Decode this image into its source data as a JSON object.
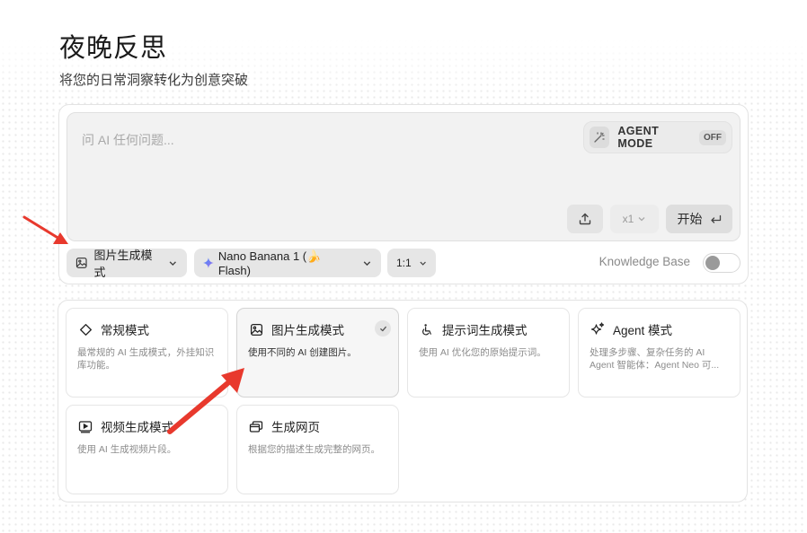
{
  "header": {
    "title": "夜晚反思",
    "subtitle": "将您的日常洞察转化为创意突破"
  },
  "composer": {
    "placeholder": "问 AI 任何问题...",
    "agent_mode_label": "AGENT MODE",
    "agent_mode_state": "OFF",
    "count_label": "x1",
    "start_label": "开始"
  },
  "options": {
    "mode_label": "图片生成模式",
    "model_label": "Nano Banana 1 (🍌 Flash)",
    "ratio_label": "1:1",
    "knowledge_base_label": "Knowledge Base",
    "knowledge_base_on": false
  },
  "modes": [
    {
      "title": "常规模式",
      "desc": "最常规的 AI 生成模式，外挂知识库功能。",
      "icon": "diamond-icon",
      "selected": false
    },
    {
      "title": "图片生成模式",
      "desc": "使用不同的 AI 创建图片。",
      "icon": "image-icon",
      "selected": true
    },
    {
      "title": "提示词生成模式",
      "desc": "使用 AI 优化您的原始提示词。",
      "icon": "wheelchair-icon",
      "selected": false
    },
    {
      "title": "Agent 模式",
      "desc": "处理多步骤、复杂任务的 AI Agent 智能体：Agent Neo 可...",
      "icon": "sparkles-icon",
      "selected": false
    },
    {
      "title": "视频生成模式",
      "desc": "使用 AI 生成视频片段。",
      "icon": "video-icon",
      "selected": false
    },
    {
      "title": "生成网页",
      "desc": "根据您的描述生成完整的网页。",
      "icon": "browser-windows-icon",
      "selected": false
    }
  ],
  "colors": {
    "annotation_arrow": "#e8392d",
    "panel_border": "#e3e3e3",
    "pill_background": "#e6e6e6"
  }
}
